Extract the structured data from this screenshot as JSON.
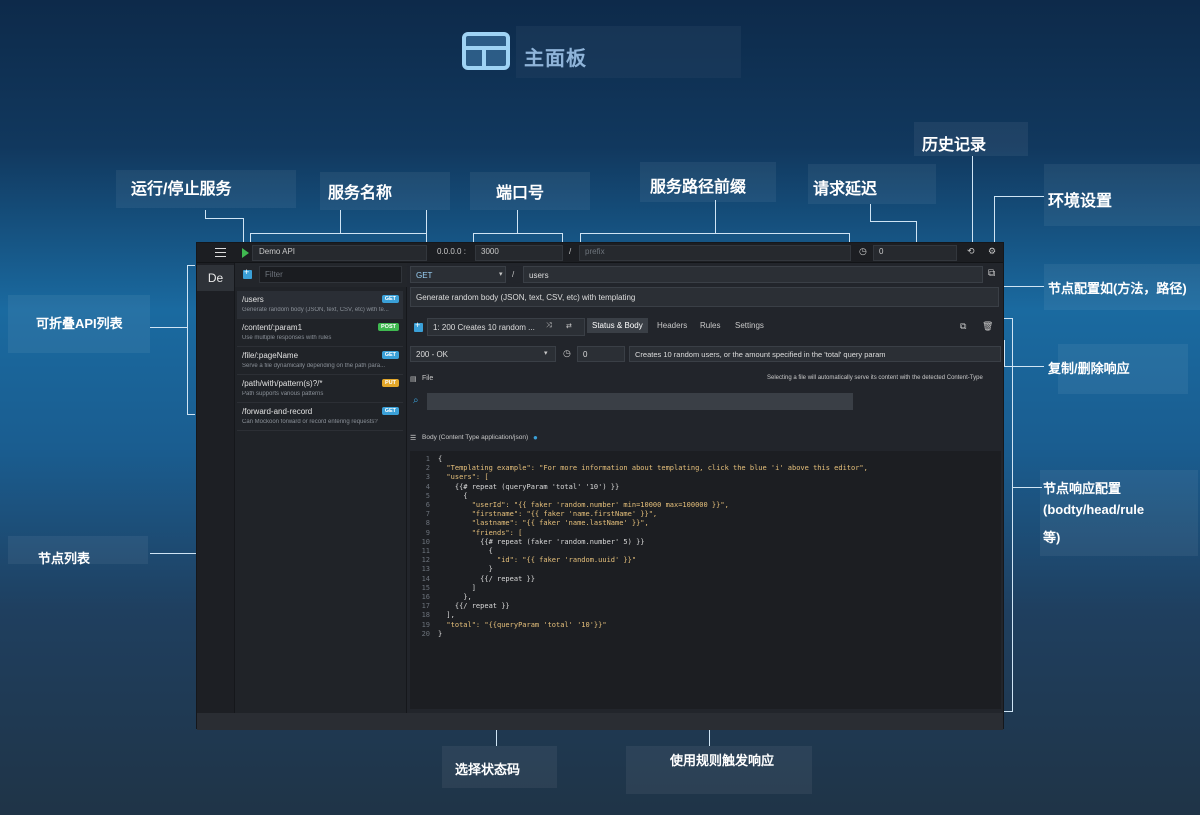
{
  "header": {
    "title": "主面板"
  },
  "annotations": {
    "run_stop": "运行/停止服务",
    "service_name": "服务名称",
    "port": "端口号",
    "prefix": "服务路径前缀",
    "latency": "请求延迟",
    "history": "历史记录",
    "env_settings": "环境设置",
    "collapsible_list": "可折叠API列表",
    "node_config": "节点配置如(方法，路径)",
    "copy_delete": "复制/删除响应",
    "node_list": "节点列表",
    "response_config_l1": "节点响应配置",
    "response_config_l2": "(bodty/head/rule",
    "response_config_l3": "等)",
    "status_code": "选择状态码",
    "rule_trigger": "使用规则触发响应"
  },
  "app": {
    "env_short": "De",
    "service_name": "Demo API",
    "host": "0.0.0.0 :",
    "port": "3000",
    "slash": "/",
    "prefix_placeholder": "prefix",
    "latency": "0",
    "filter_placeholder": "Filter",
    "routes": [
      {
        "path": "/users",
        "desc": "Generate random body (JSON, text, CSV, etc) with te...",
        "method": "GET",
        "color": "#3aa0d8"
      },
      {
        "path": "/content/:param1",
        "desc": "Use multiple responses with rules",
        "method": "POST",
        "color": "#3fb950"
      },
      {
        "path": "/file/:pageName",
        "desc": "Serve a file dynamically depending on the path para...",
        "method": "GET",
        "color": "#3aa0d8"
      },
      {
        "path": "/path/with/pattern(s)?/*",
        "desc": "Path supports various patterns",
        "method": "PUT",
        "color": "#e3a72a"
      },
      {
        "path": "/forward-and-record",
        "desc": "Can Mockoon forward or record entering requests?",
        "method": "GET",
        "color": "#3aa0d8"
      }
    ],
    "route_method": "GET",
    "route_path": "users",
    "route_desc": "Generate random body (JSON, text, CSV, etc) with templating",
    "response_label": "1: 200   Creates 10 random ...",
    "tabs": [
      "Status & Body",
      "Headers",
      "Rules",
      "Settings"
    ],
    "status": "200 - OK",
    "resp_latency": "0",
    "resp_desc": "Creates 10 random users, or the amount specified in the 'total' query param",
    "file_label": "File",
    "file_hint": "Selecting a file will automatically serve its content with the detected Content-Type",
    "body_label": "Body (Content Type application/json)",
    "code": [
      "{",
      "  \"Templating example\": \"For more information about templating, click the blue 'i' above this editor\",",
      "  \"users\": [",
      "    {{# repeat (queryParam 'total' '10') }}",
      "      {",
      "        \"userId\": \"{{ faker 'random.number' min=10000 max=100000 }}\",",
      "        \"firstname\": \"{{ faker 'name.firstName' }}\",",
      "        \"lastname\": \"{{ faker 'name.lastName' }}\",",
      "        \"friends\": [",
      "          {{# repeat (faker 'random.number' 5) }}",
      "            {",
      "              \"id\": \"{{ faker 'random.uuid' }}\"",
      "            }",
      "          {{/ repeat }}",
      "        ]",
      "      },",
      "    {{/ repeat }}",
      "  ],",
      "  \"total\": \"{{queryParam 'total' '10'}}\"",
      "}"
    ]
  }
}
